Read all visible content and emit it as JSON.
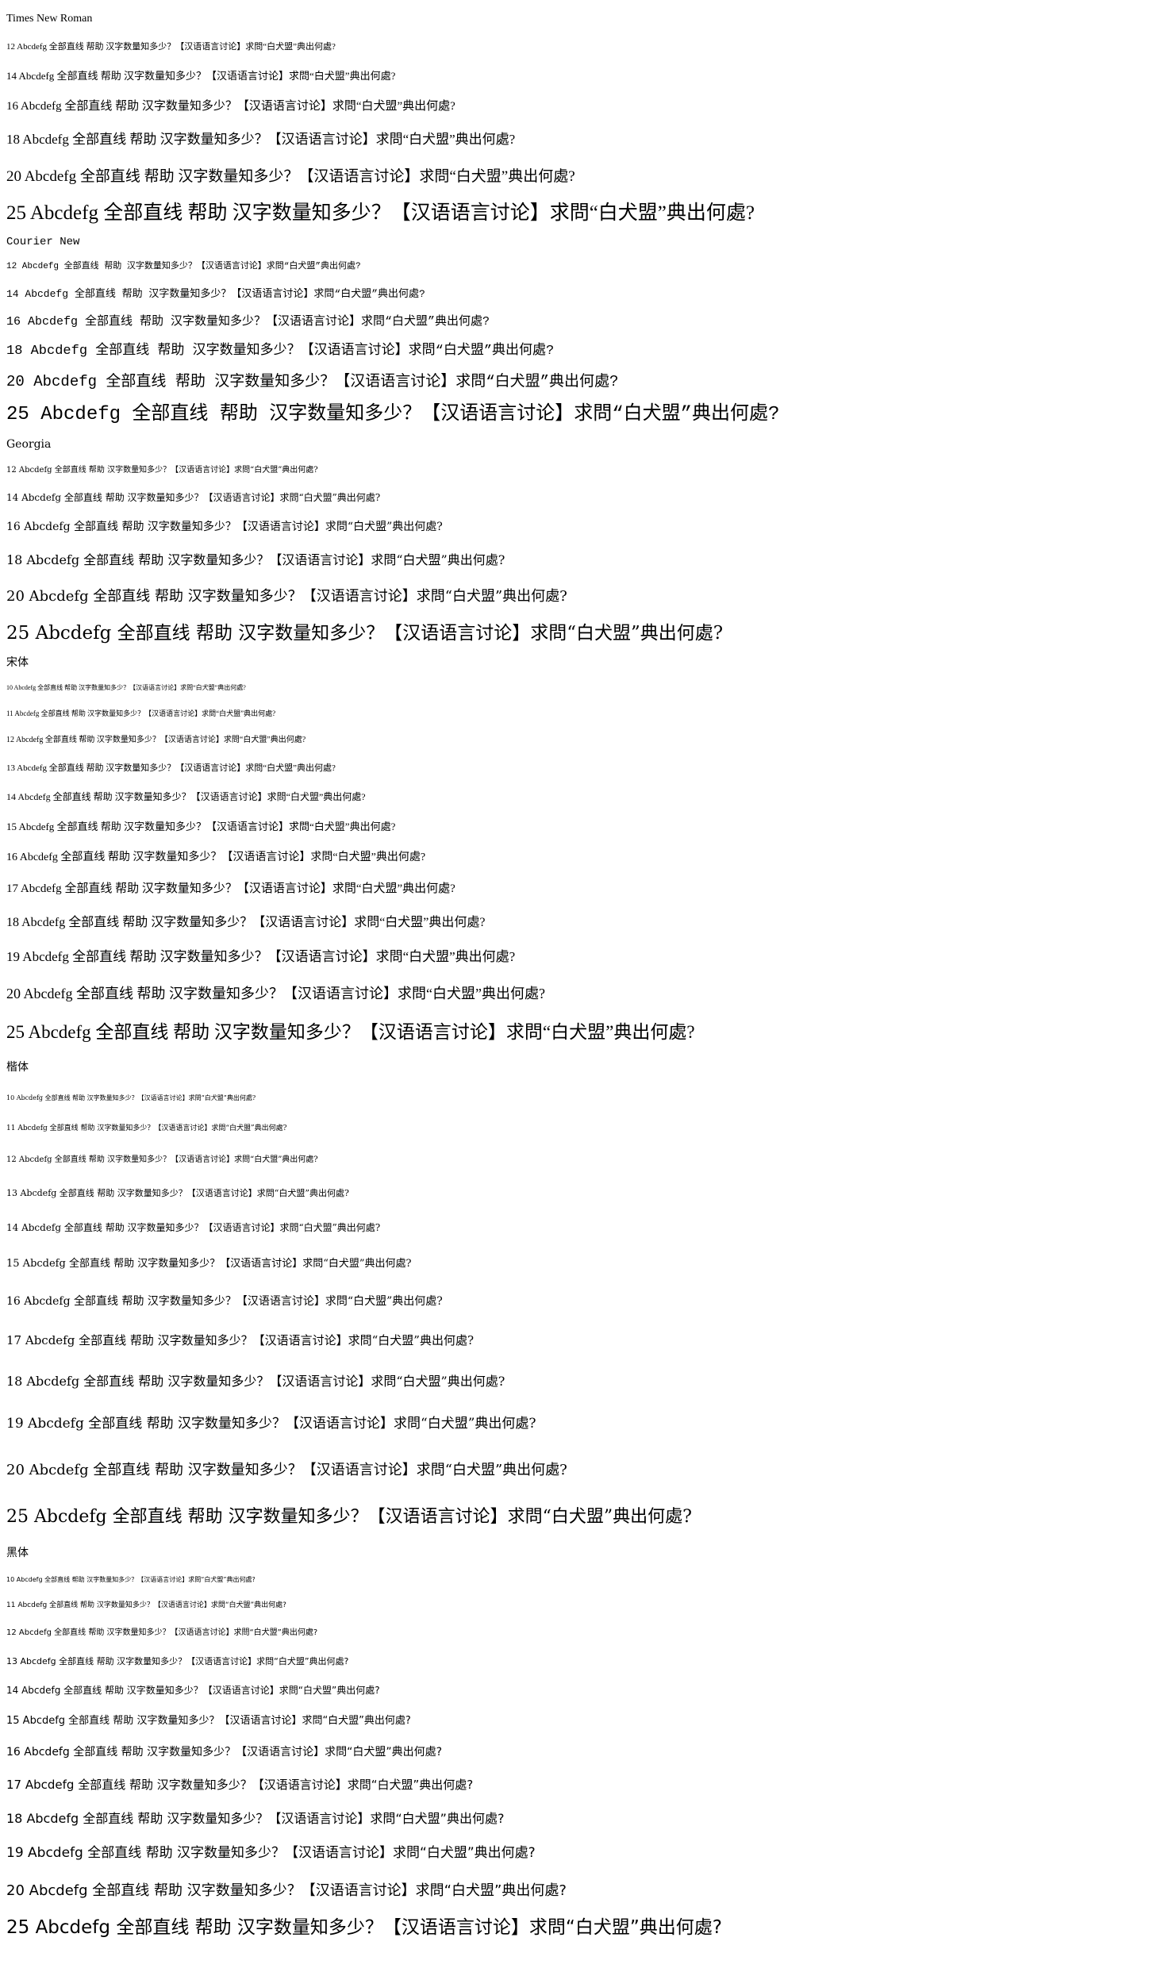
{
  "sample_text": "Abcdefg 全部直线 帮助 汉字数量知多少？【汉语语言讨论】求問“白犬盟”典出何處?",
  "sections": [
    {
      "key": "tnr",
      "title": "Times New Roman",
      "title_size": 14,
      "title_height": 35,
      "lines": [
        {
          "label": "12 Abcdefg 全部直线 帮助 汉字数量知多少？【汉语语言讨论】求問“白犬盟”典出何處?",
          "size": 11,
          "height": 36
        },
        {
          "label": "14 Abcdefg 全部直线 帮助 汉字数量知多少？【汉语语言讨论】求問“白犬盟”典出何處?",
          "size": 13,
          "height": 38
        },
        {
          "label": "16 Abcdefg 全部直线 帮助 汉字数量知多少？【汉语语言讨论】求問“白犬盟”典出何處?",
          "size": 15,
          "height": 39
        },
        {
          "label": "18 Abcdefg 全部直线 帮助 汉字数量知多少？【汉语语言讨论】求問“白犬盟”典出何處?",
          "size": 17,
          "height": 44
        },
        {
          "label": "20 Abcdefg 全部直线 帮助 汉字数量知多少？【汉语语言讨论】求問“白犬盟”典出何處?",
          "size": 19,
          "height": 49
        },
        {
          "label": "25 Abcdefg 全部直线 帮助 汉字数量知多少？【汉语语言讨论】求問“白犬盟”典出何處?",
          "size": 25,
          "height": 43
        }
      ]
    },
    {
      "key": "cour",
      "title": "Courier New",
      "title_size": 14,
      "title_height": 30,
      "lines": [
        {
          "label": "12 Abcdefg 全部直线 帮助 汉字数量知多少？【汉语语言讨论】求問“白犬盟”典出何處?",
          "size": 11,
          "height": 33
        },
        {
          "label": "14 Abcdefg 全部直线 帮助 汉字数量知多少？【汉语语言讨论】求問“白犬盟”典出何處?",
          "size": 13,
          "height": 35
        },
        {
          "label": "16 Abcdefg 全部直线 帮助 汉字数量知多少？【汉语语言讨论】求問“白犬盟”典出何處?",
          "size": 15,
          "height": 36
        },
        {
          "label": "18 Abcdefg 全部直线 帮助 汉字数量知多少？【汉语语言讨论】求問“白犬盟”典出何處?",
          "size": 17,
          "height": 37
        },
        {
          "label": "20 Abcdefg 全部直线 帮助 汉字数量知多少？【汉语语言讨论】求問“白犬盟”典出何處?",
          "size": 19,
          "height": 41
        },
        {
          "label": "25 Abcdefg 全部直线 帮助 汉字数量知多少？【汉语语言讨论】求問“白犬盟”典出何處?",
          "size": 24,
          "height": 42
        }
      ]
    },
    {
      "key": "geo",
      "title": "Georgia",
      "title_size": 14,
      "title_height": 32,
      "lines": [
        {
          "label": "12 Abcdefg 全部直线 帮助 汉字数量知多少？【汉语语言讨论】求問“白犬盟”典出何處?",
          "size": 10,
          "height": 33
        },
        {
          "label": "14 Abcdefg 全部直线 帮助 汉字数量知多少？【汉语语言讨论】求問“白犬盟”典出何處?",
          "size": 12,
          "height": 36
        },
        {
          "label": "16 Abcdefg 全部直线 帮助 汉字数量知多少？【汉语语言讨论】求問“白犬盟”典出何處?",
          "size": 14,
          "height": 39
        },
        {
          "label": "18 Abcdefg 全部直线 帮助 汉字数量知多少？【汉语语言讨论】求問“白犬盟”典出何處?",
          "size": 16,
          "height": 44
        },
        {
          "label": "20 Abcdefg 全部直线 帮助 汉字数量知多少？【汉语语言讨论】求問“白犬盟”典出何處?",
          "size": 18,
          "height": 48
        },
        {
          "label": "25 Abcdefg 全部直线 帮助 汉字数量知多少？【汉语语言讨论】求問“白犬盟”典出何處?",
          "size": 23,
          "height": 45
        }
      ]
    },
    {
      "key": "song",
      "title": "宋体",
      "title_size": 14,
      "title_height": 30,
      "lines": [
        {
          "label": "10 Abcdefg 全部直线 帮助 汉字数量知多少？【汉语语言讨论】求問“白犬盟”典出何處?",
          "size": 8,
          "height": 32
        },
        {
          "label": "11 Abcdefg 全部直线 帮助 汉字数量知多少？【汉语语言讨论】求問“白犬盟”典出何處?",
          "size": 9,
          "height": 33
        },
        {
          "label": "12 Abcdefg 全部直线 帮助 汉字数量知多少？【汉语语言讨论】求問“白犬盟”典出何處?",
          "size": 10,
          "height": 34
        },
        {
          "label": "13 Abcdefg 全部直线 帮助 汉字数量知多少？【汉语语言讨论】求問“白犬盟”典出何處?",
          "size": 11,
          "height": 36
        },
        {
          "label": "14 Abcdefg 全部直线 帮助 汉字数量知多少？【汉语语言讨论】求問“白犬盟”典出何處?",
          "size": 12,
          "height": 37
        },
        {
          "label": "15 Abcdefg 全部直线 帮助 汉字数量知多少？【汉语语言讨论】求問“白犬盟”典出何處?",
          "size": 13,
          "height": 38
        },
        {
          "label": "16 Abcdefg 全部直线 帮助 汉字数量知多少？【汉语语言讨论】求問“白犬盟”典出何處?",
          "size": 14,
          "height": 39
        },
        {
          "label": "17 Abcdefg 全部直线 帮助 汉字数量知多少？【汉语语言讨论】求問“白犬盟”典出何處?",
          "size": 15,
          "height": 41
        },
        {
          "label": "18 Abcdefg 全部直线 帮助 汉字数量知多少？【汉语语言讨论】求問“白犬盟”典出何處?",
          "size": 16,
          "height": 43
        },
        {
          "label": "19 Abcdefg 全部直线 帮助 汉字数量知多少？【汉语语言讨论】求問“白犬盟”典出何處?",
          "size": 17,
          "height": 44
        },
        {
          "label": "20 Abcdefg 全部直线 帮助 汉字数量知多少？【汉语语言讨论】求問“白犬盟”典出何處?",
          "size": 18,
          "height": 49
        },
        {
          "label": "25 Abcdefg 全部直线 帮助 汉字数量知多少？【汉语语言讨论】求問“白犬盟”典出何處?",
          "size": 23,
          "height": 48
        }
      ]
    },
    {
      "key": "kai",
      "title": "楷体",
      "title_size": 14,
      "title_height": 40,
      "lines": [
        {
          "label": "10 Abcdefg 全部直线 帮助 汉字数量知多少？【汉语语言讨论】求問“白犬盟”典出何處?",
          "size": 8,
          "height": 38
        },
        {
          "label": "11 Abcdefg 全部直线 帮助 汉字数量知多少？【汉语语言讨论】求問“白犬盟”典出何處?",
          "size": 9,
          "height": 38
        },
        {
          "label": "12 Abcdefg 全部直线 帮助 汉字数量知多少？【汉语语言讨论】求問“白犬盟”典出何處?",
          "size": 10,
          "height": 42
        },
        {
          "label": "13 Abcdefg 全部直线 帮助 汉字数量知多少？【汉语语言讨论】求問“白犬盟”典出何處?",
          "size": 11,
          "height": 42
        },
        {
          "label": "14 Abcdefg 全部直线 帮助 汉字数量知多少？【汉语语言讨论】求問“白犬盟”典出何處?",
          "size": 12,
          "height": 44
        },
        {
          "label": "15 Abcdefg 全部直线 帮助 汉字数量知多少？【汉语语言讨论】求問“白犬盟”典出何處?",
          "size": 13,
          "height": 47
        },
        {
          "label": "16 Abcdefg 全部直线 帮助 汉字数量知多少？【汉语语言讨论】求問“白犬盟”典出何處?",
          "size": 14,
          "height": 48
        },
        {
          "label": "17 Abcdefg 全部直线 帮助 汉字数量知多少？【汉语语言讨论】求問“白犬盟”典出何處?",
          "size": 15,
          "height": 50
        },
        {
          "label": "18 Abcdefg 全部直线 帮助 汉字数量知多少？【汉语语言讨论】求問“白犬盟”典出何處?",
          "size": 16,
          "height": 53
        },
        {
          "label": "19 Abcdefg 全部直线 帮助 汉字数量知多少？【汉语语言讨论】求問“白犬盟”典出何處?",
          "size": 17,
          "height": 55
        },
        {
          "label": "20 Abcdefg 全部直线 帮助 汉字数量知多少？【汉语语言讨论】求問“白犬盟”典出何處?",
          "size": 18,
          "height": 62
        },
        {
          "label": "25 Abcdefg 全部直线 帮助 汉字数量知多少？【汉语语言讨论】求問“白犬盟”典出何處?",
          "size": 22,
          "height": 56
        }
      ]
    },
    {
      "key": "hei",
      "title": "黑体",
      "title_size": 14,
      "title_height": 34,
      "lines": [
        {
          "label": "10 Abcdefg 全部直线 帮助 汉字数量知多少？【汉语语言讨论】求問“白犬盟”典出何處?",
          "size": 8,
          "height": 33
        },
        {
          "label": "11 Abcdefg 全部直线 帮助 汉字数量知多少？【汉语语言讨论】求問“白犬盟”典出何處?",
          "size": 9,
          "height": 33
        },
        {
          "label": "12 Abcdefg 全部直线 帮助 汉字数量知多少？【汉语语言讨论】求問“白犬盟”典出何處?",
          "size": 10,
          "height": 36
        },
        {
          "label": "13 Abcdefg 全部直线 帮助 汉字数量知多少？【汉语语言讨论】求問“白犬盟”典出何處?",
          "size": 11,
          "height": 36
        },
        {
          "label": "14 Abcdefg 全部直线 帮助 汉字数量知多少？【汉语语言讨论】求問“白犬盟”典出何處?",
          "size": 12,
          "height": 37
        },
        {
          "label": "15 Abcdefg 全部直线 帮助 汉字数量知多少？【汉语语言讨论】求問“白犬盟”典出何處?",
          "size": 13,
          "height": 39
        },
        {
          "label": "16 Abcdefg 全部直线 帮助 汉字数量知多少？【汉语语言讨论】求問“白犬盟”典出何處?",
          "size": 14,
          "height": 40
        },
        {
          "label": "17 Abcdefg 全部直线 帮助 汉字数量知多少？【汉语语言讨论】求問“白犬盟”典出何處?",
          "size": 15,
          "height": 42
        },
        {
          "label": "18 Abcdefg 全部直线 帮助 汉字数量知多少？【汉语语言讨论】求問“白犬盟”典出何處?",
          "size": 16,
          "height": 43
        },
        {
          "label": "19 Abcdefg 全部直线 帮助 汉字数量知多少？【汉语语言讨论】求問“白犬盟”典出何處?",
          "size": 17,
          "height": 45
        },
        {
          "label": "20 Abcdefg 全部直线 帮助 汉字数量知多少？【汉语语言讨论】求問“白犬盟”典出何處?",
          "size": 18,
          "height": 49
        },
        {
          "label": "25 Abcdefg 全部直线 帮助 汉字数量知多少？【汉语语言讨论】求問“白犬盟”典出何處?",
          "size": 23,
          "height": 44
        }
      ]
    }
  ]
}
